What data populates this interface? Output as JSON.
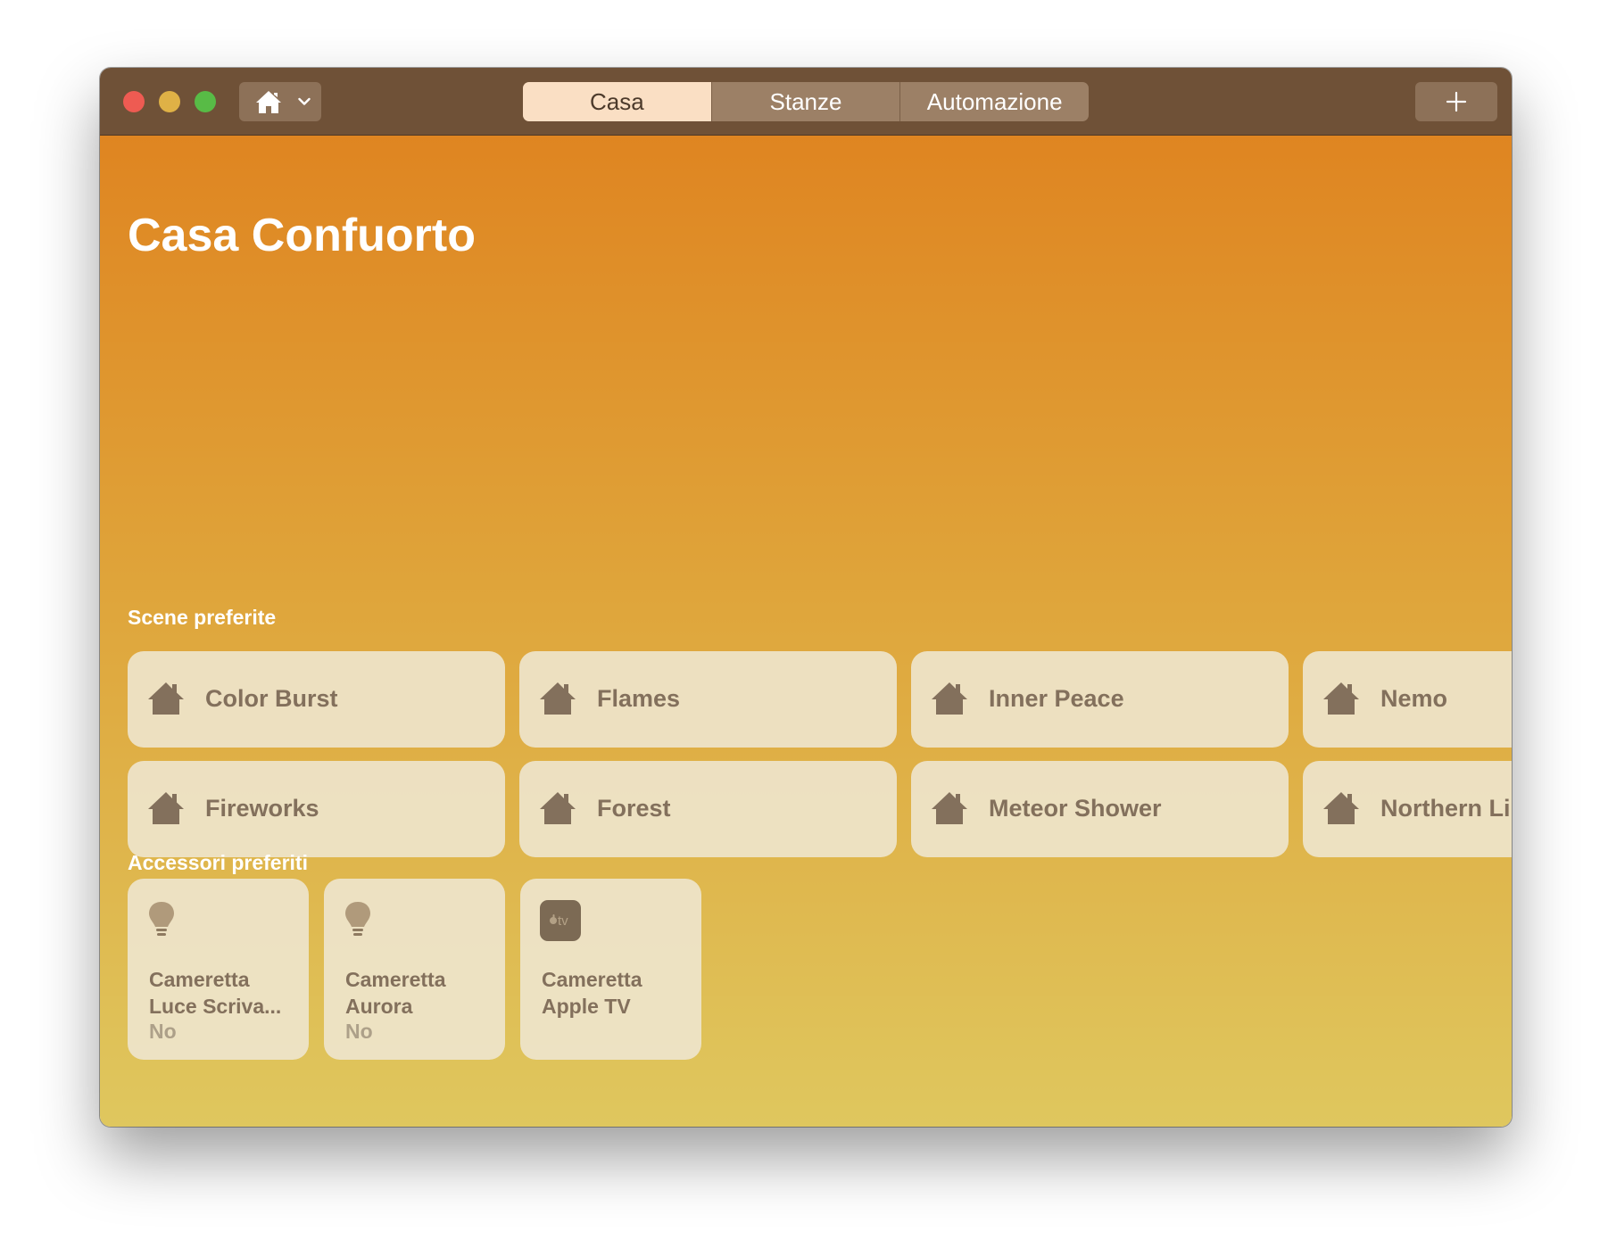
{
  "window": {
    "tabs": [
      {
        "label": "Casa",
        "active": true
      },
      {
        "label": "Stanze",
        "active": false
      },
      {
        "label": "Automazione",
        "active": false
      }
    ],
    "home_menu_icon": "house-icon",
    "add_icon": "plus-icon"
  },
  "home": {
    "title": "Casa Confuorto"
  },
  "scenes": {
    "section_label": "Scene preferite",
    "items": [
      {
        "label": "Color Burst",
        "icon": "house-icon"
      },
      {
        "label": "Flames",
        "icon": "house-icon"
      },
      {
        "label": "Inner Peace",
        "icon": "house-icon"
      },
      {
        "label": "Nemo",
        "icon": "house-icon"
      },
      {
        "label": "Fireworks",
        "icon": "house-icon"
      },
      {
        "label": "Forest",
        "icon": "house-icon"
      },
      {
        "label": "Meteor Shower",
        "icon": "house-icon"
      },
      {
        "label": "Northern Li",
        "icon": "house-icon"
      }
    ]
  },
  "accessories": {
    "section_label": "Accessori preferiti",
    "items": [
      {
        "line1": "Cameretta",
        "line2": "Luce Scriva...",
        "status": "No",
        "icon": "lightbulb-icon"
      },
      {
        "line1": "Cameretta",
        "line2": "Aurora",
        "status": "No",
        "icon": "lightbulb-icon"
      },
      {
        "line1": "Cameretta",
        "line2": "Apple TV",
        "status": "",
        "icon": "apple-tv-icon",
        "icon_text": "tv"
      }
    ]
  },
  "colors": {
    "titlebar": "#6f5137",
    "tile_text": "#83705c",
    "gradient_top": "#df8521",
    "gradient_bottom": "#dfc75e"
  }
}
